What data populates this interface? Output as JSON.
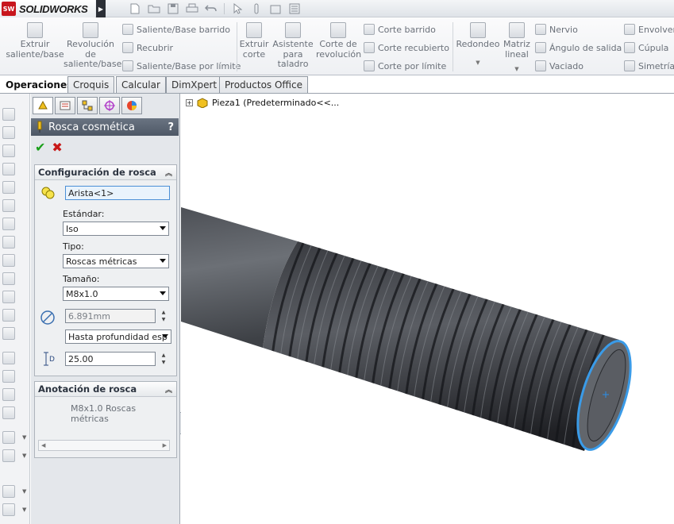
{
  "app": {
    "brand": "SOLIDWORKS",
    "logo_letters": "SW"
  },
  "ribbon": {
    "extrude_boss": "Extruir saliente/base",
    "revolve_boss": "Revolución de saliente/base",
    "swept_boss": "Saliente/Base barrido",
    "loft_boss": "Recubrir",
    "boundary_boss": "Saliente/Base por límite",
    "extrude_cut": "Extruir corte",
    "hole_wizard": "Asistente para taladro",
    "revolve_cut": "Corte de revolución",
    "swept_cut": "Corte barrido",
    "loft_cut": "Corte recubierto",
    "boundary_cut": "Corte por límite",
    "fillet": "Redondeo",
    "linear_pattern": "Matriz lineal",
    "rib": "Nervio",
    "draft": "Ángulo de salida",
    "shell": "Vaciado",
    "wrap": "Envolver",
    "dome": "Cúpula",
    "mirror": "Simetría"
  },
  "tabs": [
    "Operaciones",
    "Croquis",
    "Calcular",
    "DimXpert",
    "Productos Office"
  ],
  "property_manager": {
    "title": "Rosca cosmética",
    "help": "?",
    "ok_symbol": "✔",
    "cancel_symbol": "✖",
    "thread_settings": {
      "header": "Configuración de rosca",
      "edge_value": "Arista<1>",
      "standard_label": "Estándar:",
      "standard_value": "Iso",
      "type_label": "Tipo:",
      "type_value": "Roscas métricas",
      "size_label": "Tamaño:",
      "size_value": "M8x1.0",
      "minor_diameter": "6.891mm",
      "end_condition": "Hasta profundidad esp",
      "depth_icon_letter": "D",
      "depth_value": "25.00"
    },
    "thread_callout": {
      "header": "Anotación de rosca",
      "text": "M8x1.0 Roscas métricas"
    }
  },
  "viewport": {
    "tree_label": "Pieza1  (Predeterminado<<...",
    "colors": {
      "shaft": "#5c5f64",
      "thread": "#2b2d31",
      "highlight_edge": "#3a9be8"
    }
  }
}
